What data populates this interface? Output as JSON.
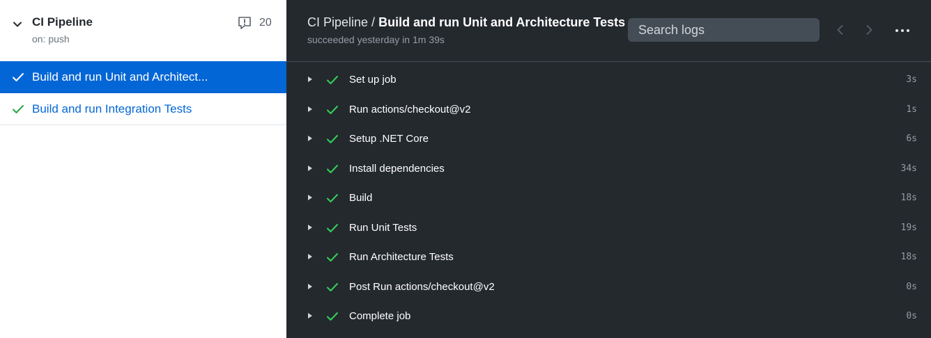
{
  "colors": {
    "sidebar_bg": "#ffffff",
    "main_bg": "#24292e",
    "accent_blue": "#0366d6",
    "success_green": "#34d058",
    "muted_text": "#959da5"
  },
  "workflow": {
    "title": "CI Pipeline",
    "trigger": "on: push",
    "annotation_icon": "comment-exclamation-icon",
    "annotation_count": "20"
  },
  "jobs": [
    {
      "label": "Build and run Unit and Architect...",
      "status": "success",
      "active": true
    },
    {
      "label": "Build and run Integration Tests",
      "status": "success",
      "active": false
    }
  ],
  "header": {
    "workflow_crumb": "CI Pipeline /",
    "job_title": "Build and run Unit and Architecture Tests",
    "run_status": "succeeded yesterday in 1m 39s",
    "search_placeholder": "Search logs"
  },
  "steps": [
    {
      "name": "Set up job",
      "duration": "3s"
    },
    {
      "name": "Run actions/checkout@v2",
      "duration": "1s"
    },
    {
      "name": "Setup .NET Core",
      "duration": "6s"
    },
    {
      "name": "Install dependencies",
      "duration": "34s"
    },
    {
      "name": "Build",
      "duration": "18s"
    },
    {
      "name": "Run Unit Tests",
      "duration": "19s"
    },
    {
      "name": "Run Architecture Tests",
      "duration": "18s"
    },
    {
      "name": "Post Run actions/checkout@v2",
      "duration": "0s"
    },
    {
      "name": "Complete job",
      "duration": "0s"
    }
  ]
}
